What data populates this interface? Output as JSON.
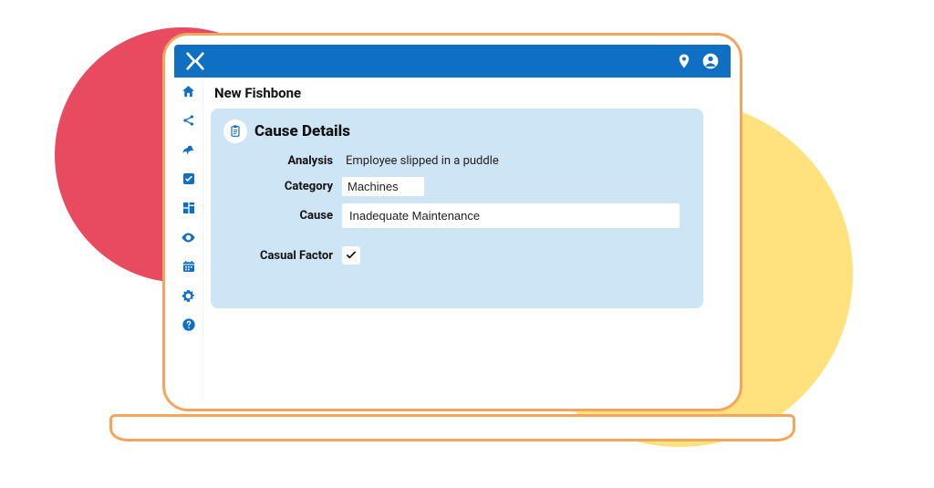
{
  "page": {
    "title": "New Fishbone"
  },
  "panel": {
    "title": "Cause Details"
  },
  "form": {
    "analysis": {
      "label": "Analysis",
      "value": "Employee slipped in a puddle"
    },
    "category": {
      "label": "Category",
      "value": "Machines"
    },
    "cause": {
      "label": "Cause",
      "value": "Inadequate Maintenance"
    },
    "casual_factor": {
      "label": "Casual Factor",
      "checked": true
    }
  },
  "colors": {
    "brand": "#0f6fc2",
    "panel_bg": "#cde5f5",
    "accent_red": "#e84a5f",
    "accent_yellow": "#ffe17d",
    "laptop_outline": "#f3a55b"
  },
  "sidebar": {
    "items": [
      {
        "name": "home"
      },
      {
        "name": "share"
      },
      {
        "name": "pin"
      },
      {
        "name": "checklist"
      },
      {
        "name": "dashboard"
      },
      {
        "name": "visibility"
      },
      {
        "name": "calendar"
      },
      {
        "name": "settings"
      },
      {
        "name": "help"
      }
    ]
  }
}
